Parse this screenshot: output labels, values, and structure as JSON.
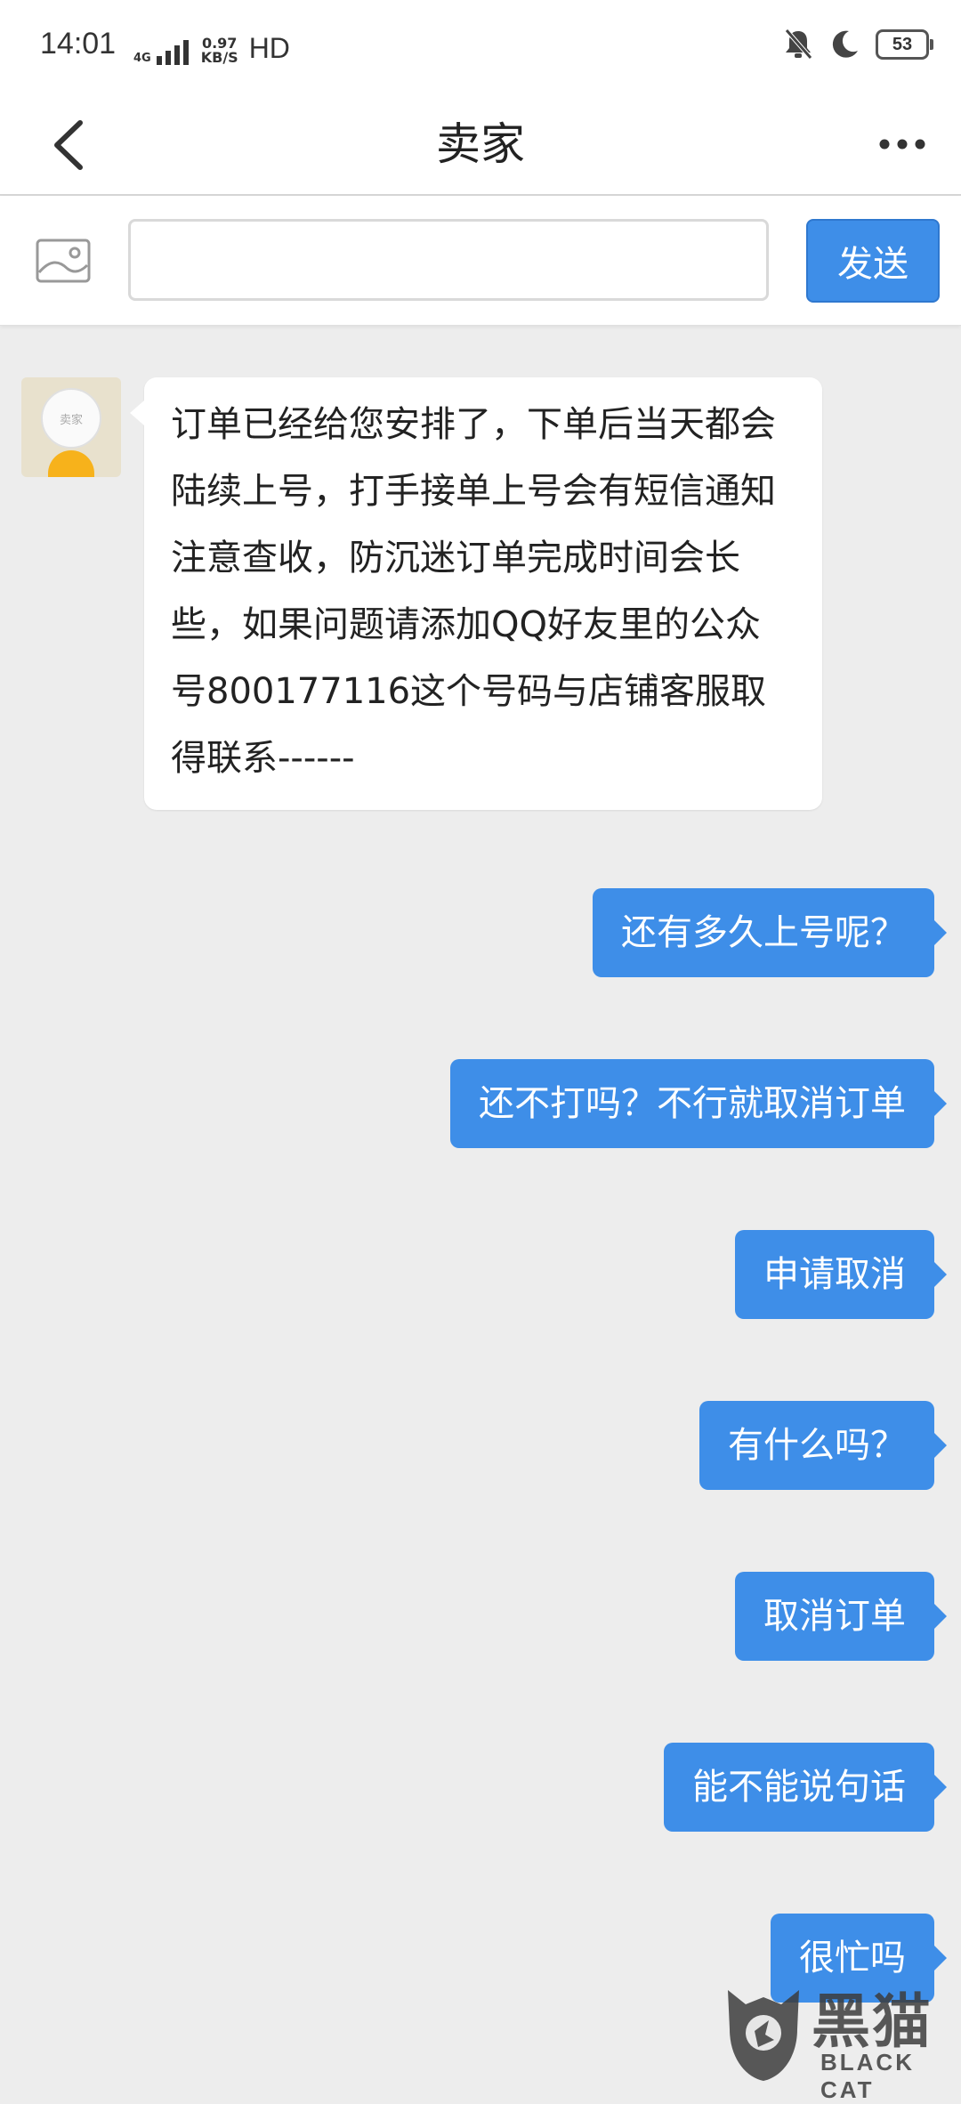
{
  "status_bar": {
    "time": "14:01",
    "network": "4G",
    "speed_value": "0.97",
    "speed_unit": "KB/S",
    "hd": "HD",
    "battery": "53"
  },
  "nav": {
    "title": "卖家"
  },
  "composer": {
    "input_value": "",
    "send_label": "发送"
  },
  "seller": {
    "avatar_label": "卖家"
  },
  "messages": [
    {
      "from": "seller",
      "text": "订单已经给您安排了，下单后当天都会陆续上号，打手接单上号会有短信通知注意查收，防沉迷订单完成时间会长些，如果问题请添加QQ好友里的公众号800177116这个号码与店铺客服取得联系------"
    },
    {
      "from": "me",
      "text": "还有多久上号呢？"
    },
    {
      "from": "me",
      "text": "还不打吗？不行就取消订单"
    },
    {
      "from": "me",
      "text": "申请取消"
    },
    {
      "from": "me",
      "text": "有什么吗？"
    },
    {
      "from": "me",
      "text": "取消订单"
    },
    {
      "from": "me",
      "text": "能不能说句话"
    },
    {
      "from": "me",
      "text": "很忙吗"
    }
  ],
  "watermark": {
    "cn": "黑猫",
    "en": "BLACK CAT"
  },
  "colors": {
    "accent": "#3e8ee8",
    "background": "#ededed"
  }
}
